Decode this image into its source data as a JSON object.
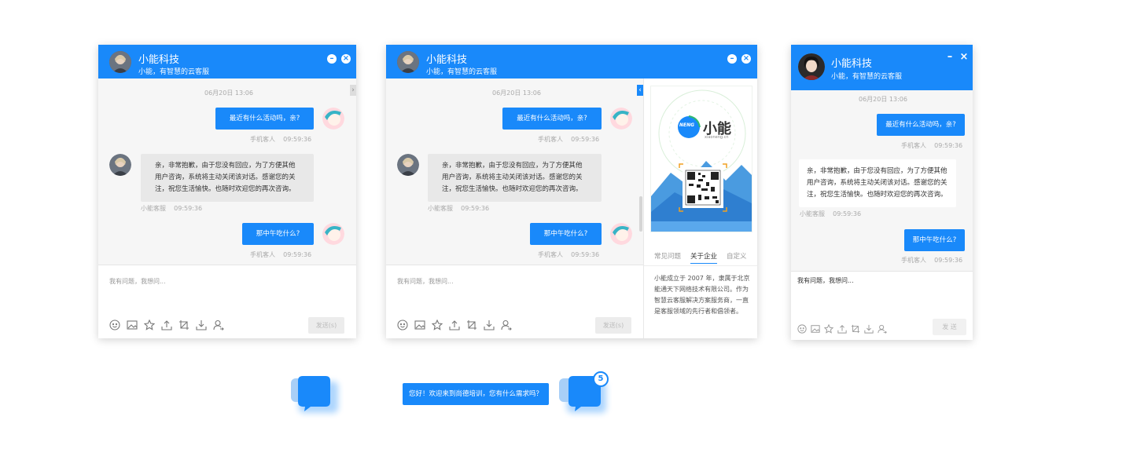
{
  "brand": {
    "name": "小能科技",
    "subtitle": "小能，有智慧的云客服"
  },
  "chat": {
    "timestamp": "06月20日 13:06",
    "messages": [
      {
        "from": "user",
        "text": "最近有什么活动吗，亲?",
        "sender": "手机客人",
        "time": "09:59:36"
      },
      {
        "from": "agent",
        "text": "亲，非常抱歉，由于您没有回应，为了方便其他用户咨询，系统将主动关闭该对话。感谢您的关注，祝您生活愉快。也随时欢迎您的再次咨询。",
        "sender": "小能客服",
        "time": "09:59:36"
      },
      {
        "from": "user",
        "text": "那中午吃什么?",
        "sender": "手机客人",
        "time": "09:59:36"
      }
    ]
  },
  "input": {
    "placeholder": "我有问题，我想问...",
    "value_mobile": "我有问题，我想问..."
  },
  "send": {
    "label": "发送(s)",
    "label_mobile": "发 送"
  },
  "side": {
    "logo_text": "小能",
    "logo_sub": "xiaoneng.cn",
    "logo_badge": "NENG",
    "tabs": [
      "常见问题",
      "关于企业",
      "自定义"
    ],
    "active_tab": 1,
    "about": "小能成立于 2007 年，隶属于北京能通天下网络技术有限公司。作为智慧云客服解决方案服务商，一直是客服领域的先行者和倡领者。"
  },
  "floats": {
    "tip": "您好！欢迎来到尚德培训，您有什么需求吗？",
    "badge": "5"
  },
  "colors": {
    "accent": "#1989fa"
  },
  "icons": [
    "smile-icon",
    "image-icon",
    "star-icon",
    "upload-icon",
    "crop-icon",
    "download-icon",
    "transfer-icon"
  ]
}
